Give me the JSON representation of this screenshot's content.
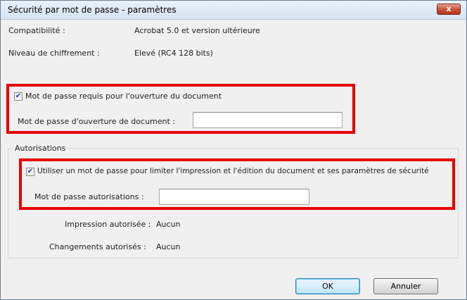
{
  "window": {
    "title": "Sécurité par mot de passe - paramètres",
    "close_glyph": "x"
  },
  "info": {
    "compat_label": "Compatibilité :",
    "compat_value": "Acrobat 5.0 et version ultérieure",
    "encryption_label": "Niveau de chiffrement :",
    "encryption_value": "Elevé (RC4 128 bits)"
  },
  "open_password": {
    "checkbox_checked": true,
    "checkbox_label": "Mot de passe requis pour l'ouverture du document",
    "field_label": "Mot de passe d'ouverture de document :",
    "field_value": ""
  },
  "permissions": {
    "group_title": "Autorisations",
    "checkbox_checked": true,
    "checkbox_label": "Utiliser un mot de passe pour limiter l'impression et l'édition du document et ses paramètres de sécurité",
    "field_label": "Mot de passe autorisations :",
    "field_value": "",
    "printing_label": "Impression autorisée :",
    "printing_value": "Aucun",
    "changes_label": "Changements autorisés :",
    "changes_value": "Aucun"
  },
  "buttons": {
    "ok_label": "OK",
    "cancel_label": "Annuler"
  },
  "colors": {
    "highlight": "#e80000",
    "title_bar": "#dbe7f4",
    "dialog_bg": "#f0f0f0"
  }
}
